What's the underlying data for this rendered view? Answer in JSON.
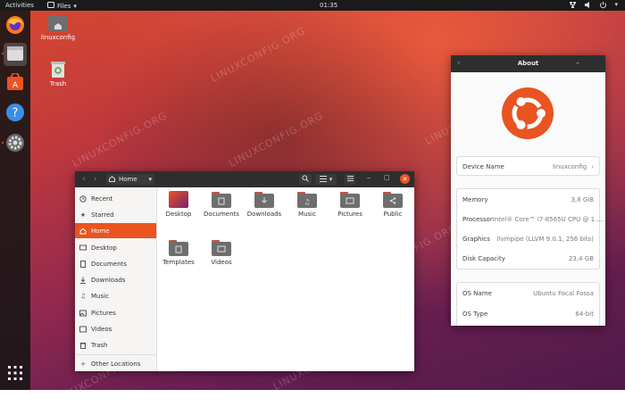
{
  "topbar": {
    "activities": "Activities",
    "app_menu": "Files",
    "clock": "01:35"
  },
  "desktop_icons": [
    {
      "label": "linuxconfig"
    },
    {
      "label": "Trash"
    }
  ],
  "watermark": "LINUXCONFIG.ORG",
  "files_window": {
    "path": "Home",
    "sidebar": [
      {
        "label": "Recent"
      },
      {
        "label": "Starred"
      },
      {
        "label": "Home"
      },
      {
        "label": "Desktop"
      },
      {
        "label": "Documents"
      },
      {
        "label": "Downloads"
      },
      {
        "label": "Music"
      },
      {
        "label": "Pictures"
      },
      {
        "label": "Videos"
      },
      {
        "label": "Trash"
      },
      {
        "label": "Other Locations"
      }
    ],
    "folders": [
      {
        "label": "Desktop"
      },
      {
        "label": "Documents"
      },
      {
        "label": "Downloads"
      },
      {
        "label": "Music"
      },
      {
        "label": "Pictures"
      },
      {
        "label": "Public"
      },
      {
        "label": "Templates"
      },
      {
        "label": "Videos"
      }
    ]
  },
  "about_window": {
    "title": "About",
    "device_name_label": "Device Name",
    "device_name_value": "linuxconfig",
    "memory_label": "Memory",
    "memory_value": "3,8 GiB",
    "processor_label": "Processor",
    "processor_value": "Intel® Core™ i7-8565U CPU @ 1....",
    "graphics_label": "Graphics",
    "graphics_value": "llvmpipe (LLVM 9.0.1, 256 bits)",
    "disk_label": "Disk Capacity",
    "disk_value": "23,4 GB",
    "os_name_label": "OS Name",
    "os_name_value": "Ubuntu Focal Fossa",
    "os_type_label": "OS Type",
    "os_type_value": "64-bit"
  },
  "colors": {
    "accent": "#e95420",
    "panel": "#1a1a1a",
    "headerbar": "#2e2e2e"
  }
}
